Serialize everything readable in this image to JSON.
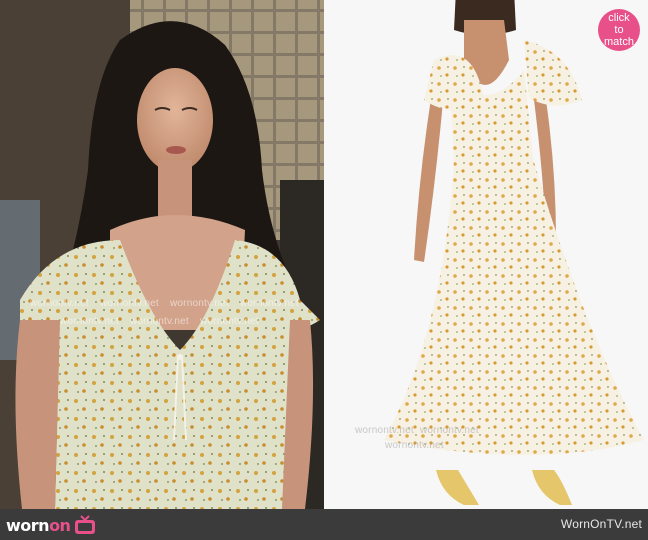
{
  "brand": {
    "logo_part1": "worn",
    "logo_part2": "on",
    "site_text": "WornOnTV.net"
  },
  "badge": {
    "line1": "click",
    "line2": "to",
    "line3": "match"
  },
  "watermark": {
    "text": "wornontv.net"
  },
  "colors": {
    "accent": "#e8508a",
    "bar": "#3b3b3b"
  },
  "icons": {
    "tv": "tv-icon"
  }
}
